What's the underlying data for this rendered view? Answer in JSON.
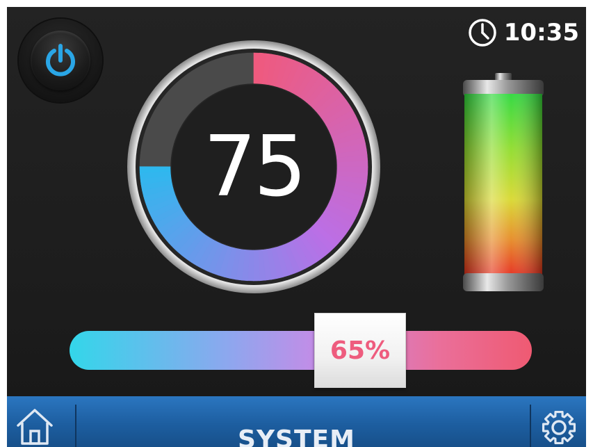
{
  "header": {
    "time": "10:35",
    "clock_icon": "clock-icon"
  },
  "power": {
    "icon": "power-icon",
    "accent": "#2aa6e6"
  },
  "dial": {
    "value": "75",
    "level_percent": 75,
    "colors": {
      "start": "#ef5a7e",
      "mid": "#bb6fe6",
      "end": "#2fb8ee",
      "empty": "#4a4a4a"
    }
  },
  "battery": {
    "icon": "battery-icon",
    "colors": {
      "top": "#2cd83a",
      "middle": "#d8d82e",
      "bottom": "#e52a1a"
    }
  },
  "slider": {
    "label": "65%",
    "value_percent": 65,
    "label_color": "#ee5c7e"
  },
  "bottom_bar": {
    "title": "SYSTEM",
    "home_icon": "home-icon",
    "settings_icon": "gear-icon"
  }
}
